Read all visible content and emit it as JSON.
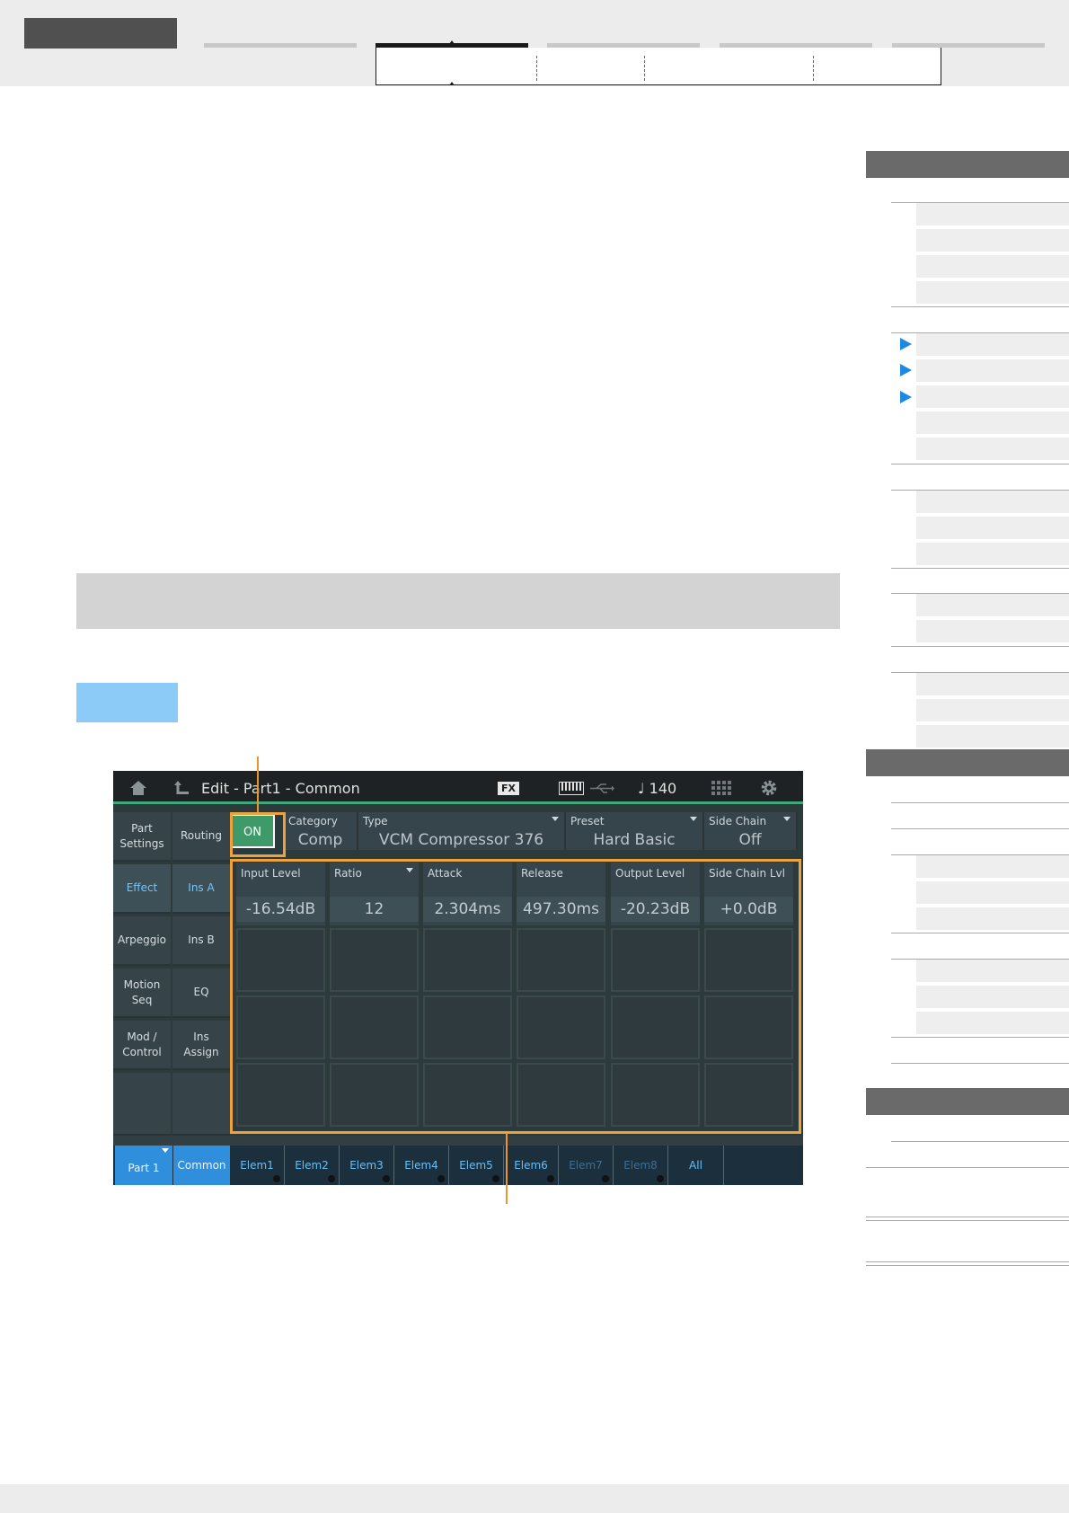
{
  "screen": {
    "title": "Edit - Part1 - Common",
    "fx_badge": "FX",
    "tempo": "♩ 140",
    "left_nav": [
      [
        "Part",
        "Settings"
      ],
      [
        "Routing"
      ],
      [
        "Effect"
      ],
      [
        "Ins A"
      ],
      [
        "Arpeggio"
      ],
      [
        "Ins B"
      ],
      [
        "Motion",
        "Seq"
      ],
      [
        "EQ"
      ],
      [
        "Mod /",
        "Control"
      ],
      [
        "Ins",
        "Assign"
      ]
    ],
    "on_button": "ON",
    "header": {
      "category_label": "Category",
      "category_value": "Comp",
      "type_label": "Type",
      "type_value": "VCM Compressor 376",
      "preset_label": "Preset",
      "preset_value": "Hard Basic",
      "sidechain_label": "Side Chain",
      "sidechain_value": "Off"
    },
    "params": [
      {
        "label": "Input Level",
        "value": "-16.54dB"
      },
      {
        "label": "Ratio",
        "value": "12"
      },
      {
        "label": "Attack",
        "value": "2.304ms"
      },
      {
        "label": "Release",
        "value": "497.30ms"
      },
      {
        "label": "Output Level",
        "value": "-20.23dB"
      },
      {
        "label": "Side Chain Lvl",
        "value": "+0.0dB"
      }
    ],
    "bottom_tabs": {
      "part": "Part 1",
      "common": "Common",
      "elems": [
        "Elem1",
        "Elem2",
        "Elem3",
        "Elem4",
        "Elem5",
        "Elem6",
        "Elem7",
        "Elem8"
      ],
      "all": "All"
    }
  },
  "colors": {
    "accent_blue": "#1e88e5",
    "callout_orange": "#f0a23a",
    "on_green": "#3e9a68"
  }
}
